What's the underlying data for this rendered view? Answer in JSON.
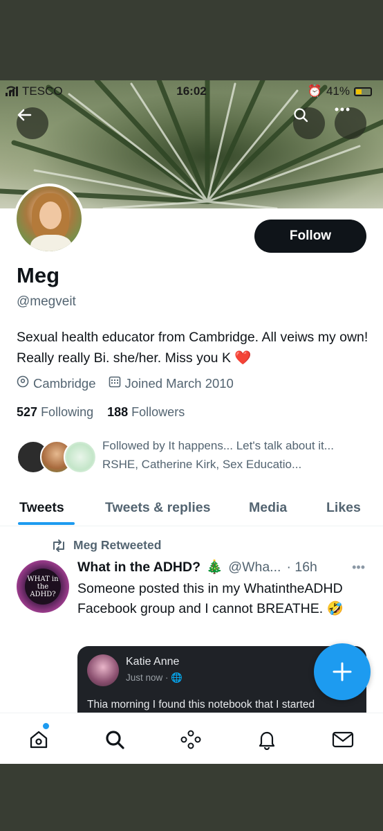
{
  "status_bar": {
    "carrier": "TESCO",
    "time": "16:02",
    "battery": "41%"
  },
  "profile": {
    "name": "Meg",
    "handle": "@megveit",
    "follow_label": "Follow",
    "bio": "Sexual health educator from Cambridge. All veiws my own! Really really Bi. she/her. Miss you K",
    "bio_emoji": "❤️",
    "location": "Cambridge",
    "joined": "Joined March 2010",
    "following_count": "527",
    "following_label": "Following",
    "followers_count": "188",
    "followers_label": "Followers",
    "followed_by": "Followed by It happens... Let's talk about it... RSHE, Catherine Kirk, Sex Educatio..."
  },
  "tabs": [
    {
      "label": "Tweets"
    },
    {
      "label": "Tweets & replies"
    },
    {
      "label": "Media"
    },
    {
      "label": "Likes"
    }
  ],
  "tweet": {
    "retweet_label": "Meg Retweeted",
    "author": "What in the ADHD?",
    "author_emoji": "🎄",
    "handle": "@Wha...",
    "time": "· 16h",
    "text": "Someone posted this in my WhatintheADHD Facebook group and I cannot BREATHE.",
    "text_emoji": "🤣",
    "avatar_text": "WHAT in the ADHD?",
    "media": {
      "name": "Katie Anne",
      "time": "Just now ·",
      "body": "Thia morning I found this notebook that I started"
    }
  },
  "colors": {
    "accent": "#1d9bf0",
    "text": "#0f1419",
    "secondary": "#536471"
  }
}
